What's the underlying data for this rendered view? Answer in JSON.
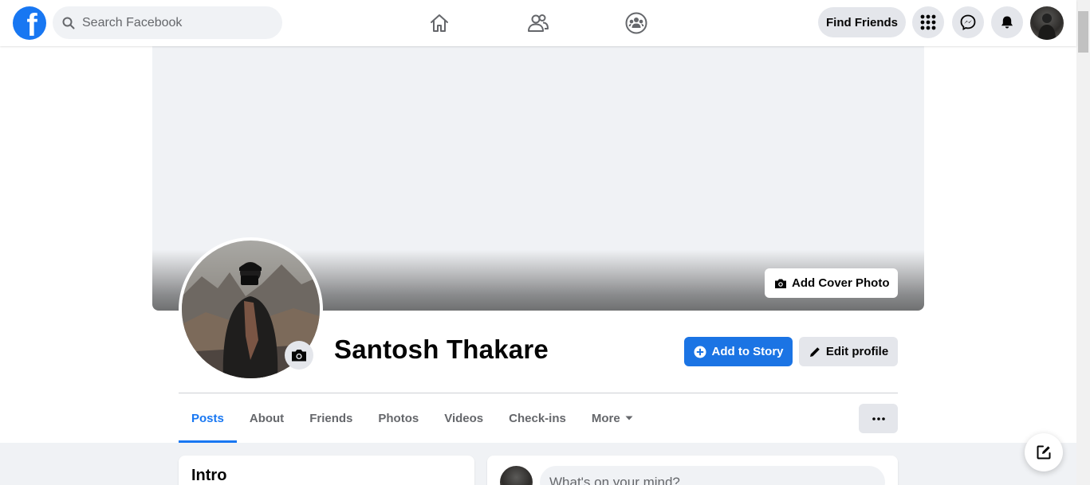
{
  "topbar": {
    "search_placeholder": "Search Facebook",
    "find_friends_label": "Find Friends",
    "nav_icons": [
      "home-icon",
      "friends-icon",
      "groups-icon"
    ],
    "right_icons": [
      "menu-grid-icon",
      "messenger-icon",
      "notifications-bell-icon"
    ]
  },
  "profile": {
    "name": "Santosh Thakare",
    "add_cover_label": "Add Cover Photo",
    "add_story_label": "Add to Story",
    "edit_profile_label": "Edit profile"
  },
  "tabs": [
    {
      "label": "Posts",
      "active": true
    },
    {
      "label": "About",
      "active": false
    },
    {
      "label": "Friends",
      "active": false
    },
    {
      "label": "Photos",
      "active": false
    },
    {
      "label": "Videos",
      "active": false
    },
    {
      "label": "Check-ins",
      "active": false
    },
    {
      "label": "More",
      "active": false
    }
  ],
  "intro": {
    "title": "Intro"
  },
  "composer": {
    "placeholder": "What's on your mind?"
  },
  "colors": {
    "accent": "#1877f2",
    "button_gray": "#e4e6eb",
    "page_bg": "#f0f2f5"
  }
}
